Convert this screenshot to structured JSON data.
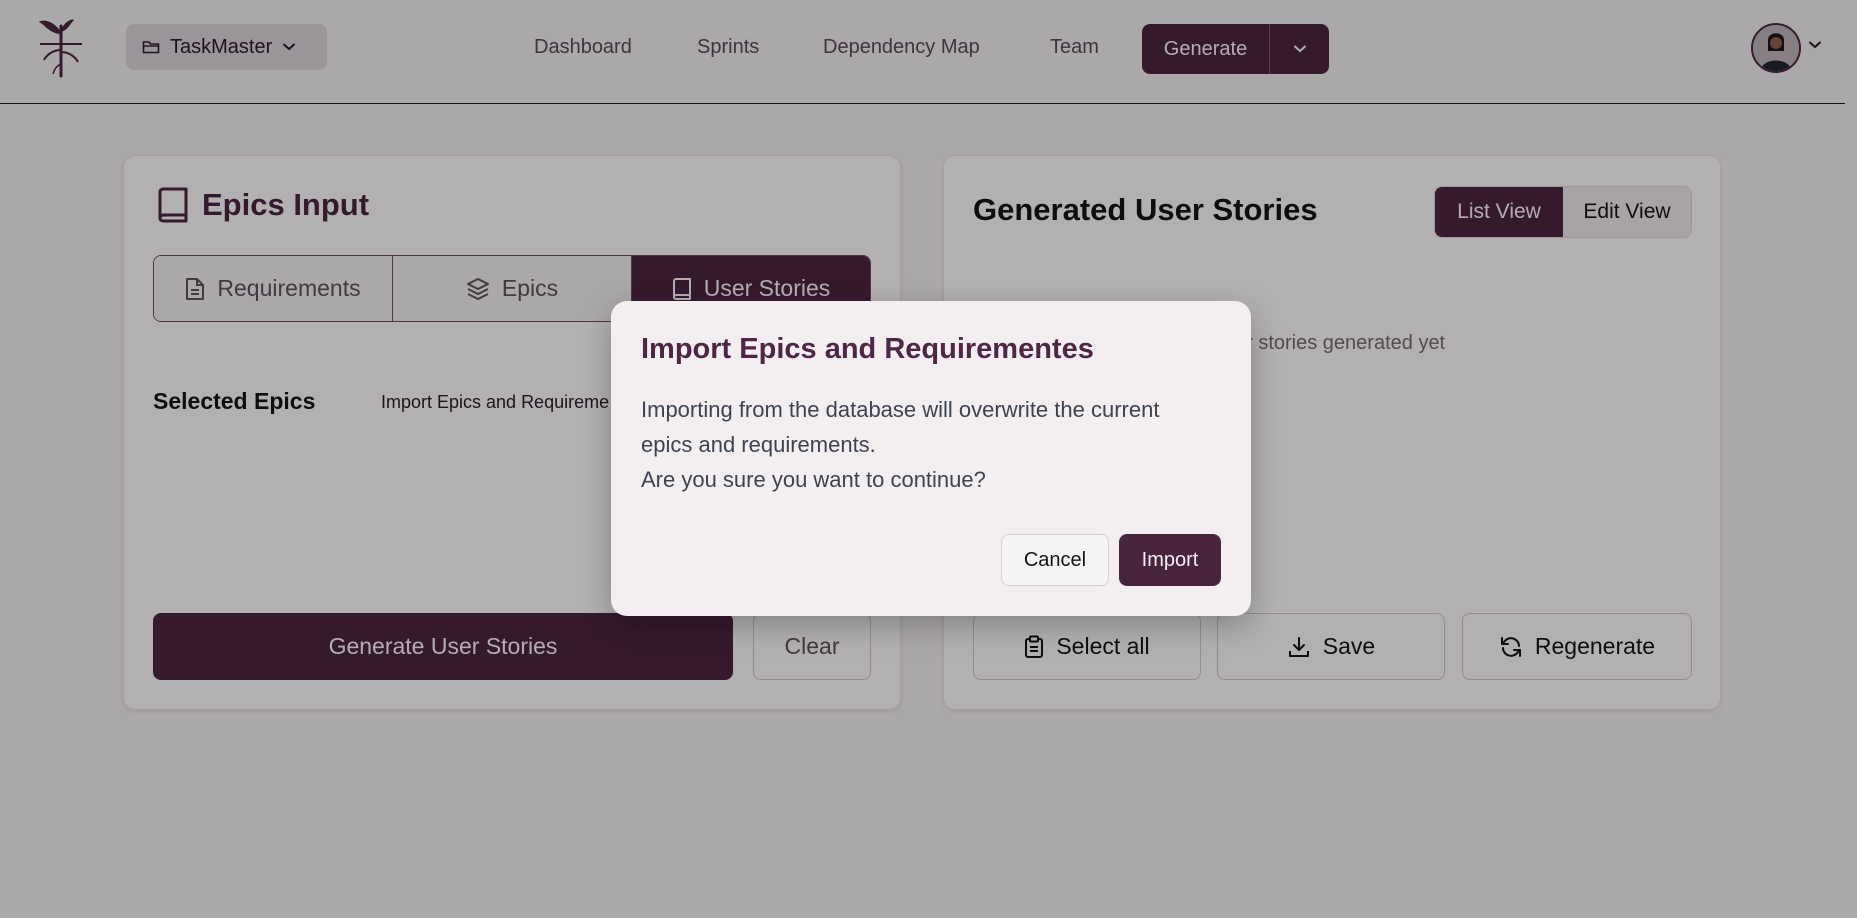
{
  "header": {
    "project": "TaskMaster",
    "nav": [
      "Dashboard",
      "Sprints",
      "Dependency Map",
      "Team"
    ],
    "generate_label": "Generate"
  },
  "epics_card": {
    "title": "Epics Input",
    "tabs": [
      {
        "label": "Requirements",
        "icon": "document-icon"
      },
      {
        "label": "Epics",
        "icon": "layers-icon"
      },
      {
        "label": "User Stories",
        "icon": "book-icon",
        "active": true
      }
    ],
    "selected_label": "Selected Epics",
    "import_link": "Import Epics and Requireme",
    "generate_button": "Generate User Stories",
    "clear_button": "Clear"
  },
  "stories_card": {
    "title": "Generated User Stories",
    "view_toggle": {
      "list": "List View",
      "edit": "Edit View",
      "selected": "List View"
    },
    "empty_text": "er stories generated yet",
    "actions": {
      "select_all": "Select all",
      "save": "Save",
      "regenerate": "Regenerate"
    }
  },
  "modal": {
    "title": "Import Epics and Requirementes",
    "body_line1": "Importing from the database will overwrite the current",
    "body_line2": "epics and requirements.",
    "body_line3": "Are you sure you want to continue?",
    "cancel": "Cancel",
    "confirm": "Import"
  },
  "colors": {
    "accent": "#49243f",
    "background": "#ebe7ea",
    "card": "#f4f1f3",
    "overlay": "rgba(0,0,0,0.27)"
  }
}
